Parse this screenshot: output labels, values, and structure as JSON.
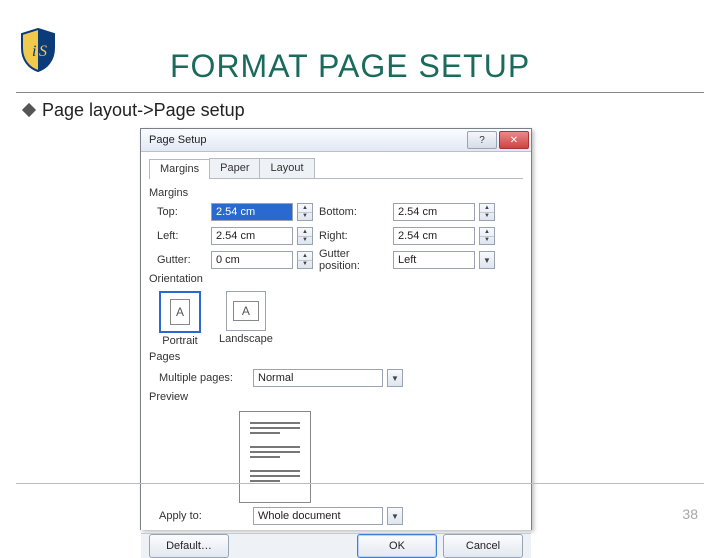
{
  "slide": {
    "title": "FORMAT PAGE SETUP",
    "bullet": "Page layout->Page setup",
    "page_number": "38"
  },
  "dialog": {
    "title": "Page Setup",
    "tabs": [
      "Margins",
      "Paper",
      "Layout"
    ],
    "groups": {
      "margins": "Margins",
      "orientation": "Orientation",
      "pages": "Pages",
      "preview": "Preview"
    },
    "margins": {
      "top": {
        "label": "Top:",
        "value": "2.54 cm"
      },
      "bottom": {
        "label": "Bottom:",
        "value": "2.54 cm"
      },
      "left": {
        "label": "Left:",
        "value": "2.54 cm"
      },
      "right": {
        "label": "Right:",
        "value": "2.54 cm"
      },
      "gutter": {
        "label": "Gutter:",
        "value": "0 cm"
      },
      "gutter_pos": {
        "label": "Gutter position:",
        "value": "Left"
      }
    },
    "orientation": {
      "portrait": "Portrait",
      "landscape": "Landscape",
      "selected": "portrait"
    },
    "pages": {
      "multiple": {
        "label": "Multiple pages:",
        "value": "Normal"
      }
    },
    "apply_to": {
      "label": "Apply to:",
      "value": "Whole document"
    },
    "buttons": {
      "default": "Default…",
      "ok": "OK",
      "cancel": "Cancel"
    }
  }
}
